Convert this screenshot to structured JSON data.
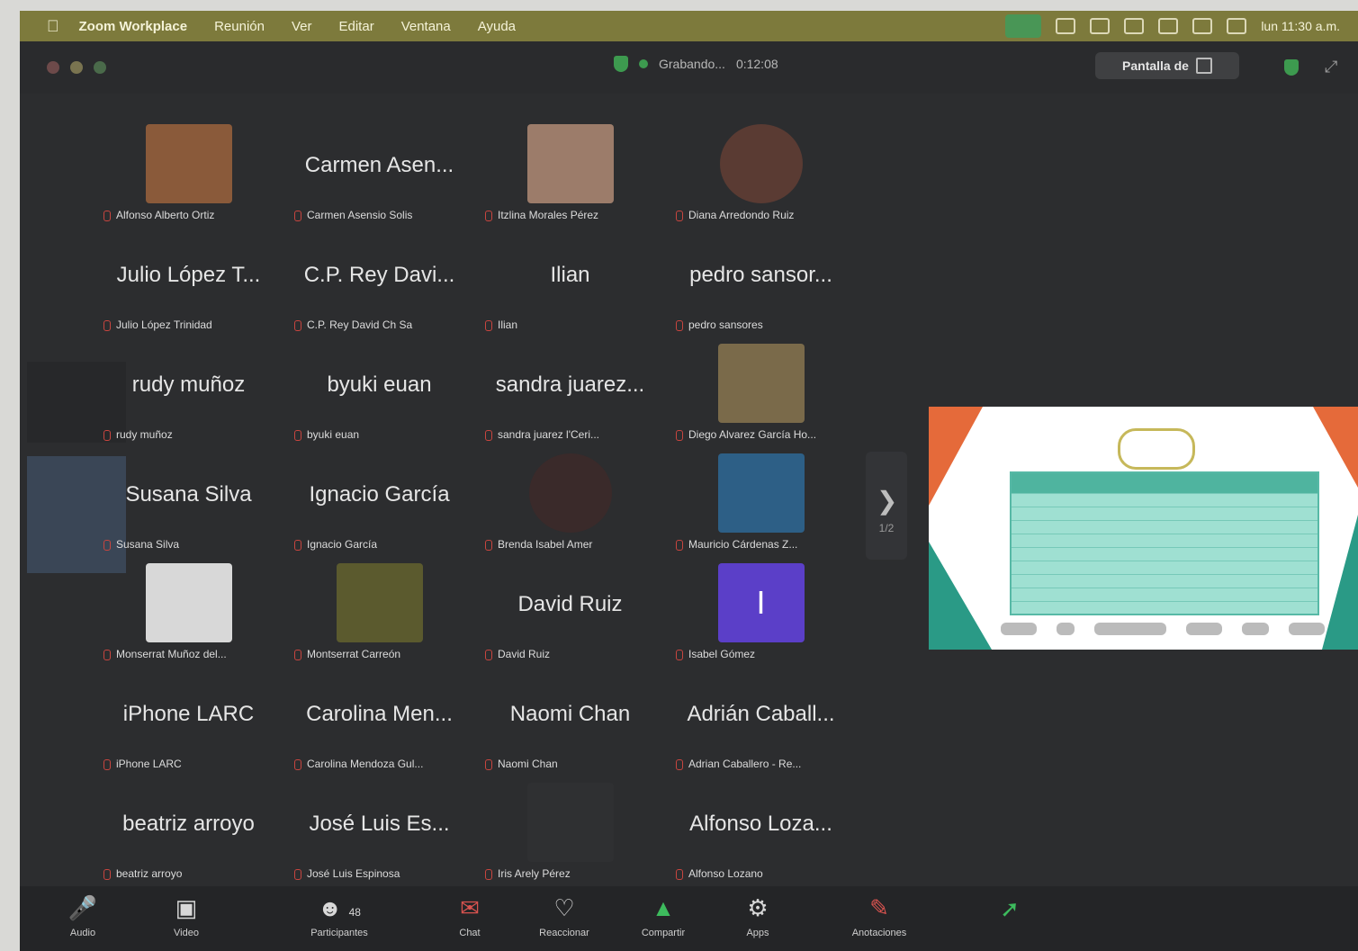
{
  "menubar": {
    "app_name": "Zoom Workplace",
    "items": [
      "Reunión",
      "Ver",
      "Editar",
      "Ventana",
      "Ayuda"
    ],
    "clock": "lun 11:30 a.m."
  },
  "titlebar": {
    "meeting_label": "Grabando...",
    "timer": "0:12:08",
    "view_button_label": "Pantalla de"
  },
  "participants": [
    {
      "big": "",
      "label": "Alfonso Alberto Ortiz",
      "photo": "#8a5a3a",
      "shape": "rect"
    },
    {
      "big": "Carmen Asen...",
      "label": "Carmen Asensio Solis"
    },
    {
      "big": "",
      "label": "Itzlina Morales Pérez",
      "photo": "#9c7c6a",
      "shape": "rect"
    },
    {
      "big": "",
      "label": "Diana Arredondo Ruiz",
      "photo": "#5a3b33",
      "shape": "round"
    },
    {
      "big": "Julio López T...",
      "label": "Julio López Trinidad"
    },
    {
      "big": "C.P. Rey Davi...",
      "label": "C.P. Rey David Ch Sa"
    },
    {
      "big": "Ilian",
      "label": "Ilian"
    },
    {
      "big": "pedro sansor...",
      "label": "pedro sansores"
    },
    {
      "big": "rudy muñoz",
      "label": "rudy muñoz"
    },
    {
      "big": "byuki euan",
      "label": "byuki euan"
    },
    {
      "big": "sandra juarez...",
      "label": "sandra juarez l'Ceri..."
    },
    {
      "big": "",
      "label": "Diego Alvarez García Ho...",
      "photo": "#7a6a4a",
      "shape": "rect"
    },
    {
      "big": "Susana Silva",
      "label": "Susana Silva"
    },
    {
      "big": "Ignacio García",
      "label": "Ignacio García"
    },
    {
      "big": "",
      "label": "Brenda Isabel Amer",
      "photo": "#3a2a2a",
      "shape": "round"
    },
    {
      "big": "",
      "label": "Mauricio Cárdenas Z...",
      "photo": "#2d5f86",
      "shape": "rect"
    },
    {
      "big": "",
      "label": "Monserrat Muñoz del...",
      "photo": "#d8d8d8",
      "shape": "rect"
    },
    {
      "big": "",
      "label": "Montserrat Carreón",
      "photo": "#5b5a2e",
      "shape": "rect"
    },
    {
      "big": "David Ruiz",
      "label": "David Ruiz"
    },
    {
      "big": "",
      "label": "Isabel Gómez",
      "photo": "#5b3fc8",
      "shape": "letter",
      "letter": "I"
    },
    {
      "big": "iPhone LARC",
      "label": "iPhone LARC"
    },
    {
      "big": "Carolina Men...",
      "label": "Carolina Mendoza Gul..."
    },
    {
      "big": "Naomi Chan",
      "label": "Naomi Chan"
    },
    {
      "big": "Adrián Caball...",
      "label": "Adrian Caballero - Re..."
    },
    {
      "big": "beatriz arroyo",
      "label": "beatriz arroyo"
    },
    {
      "big": "José Luis Es...",
      "label": "José Luis Espinosa"
    },
    {
      "big": "",
      "label": "Iris Arely Pérez",
      "photo": "#2f3032",
      "shape": "rect"
    },
    {
      "big": "Alfonso Loza...",
      "label": "Alfonso Lozano"
    }
  ],
  "toolbar": {
    "audio": "Audio",
    "video": "Video",
    "participants": "Participantes",
    "participants_count": "48",
    "chat": "Chat",
    "react": "Reaccionar",
    "share": "Compartir",
    "apps": "Apps",
    "whiteboards": "Anotaciones"
  },
  "pager": "1/2",
  "colors": {
    "menubar": "#7d7a3c",
    "window": "#2c2d2f",
    "share_green": "#3dbb5d",
    "slide_orange": "#e56a3a",
    "slide_teal": "#2a9a86"
  }
}
